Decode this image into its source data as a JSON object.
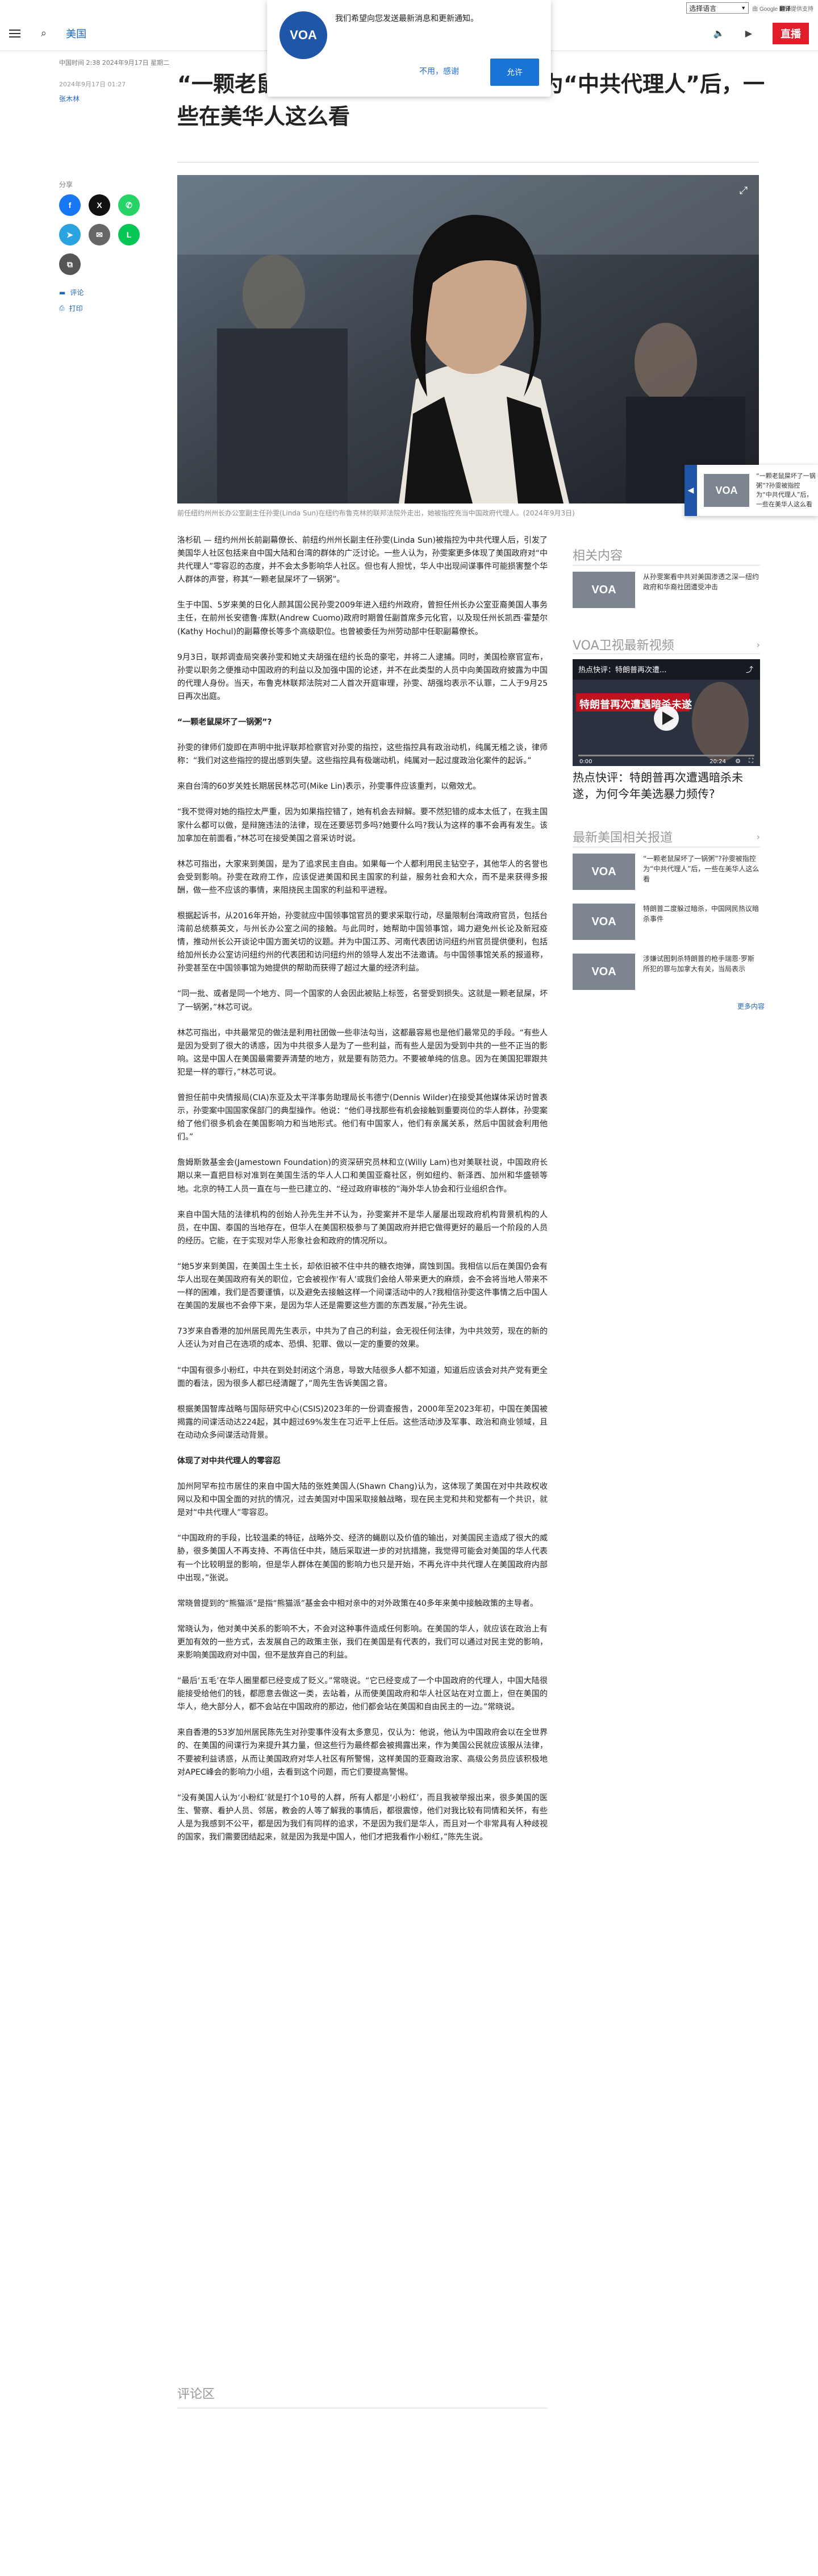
{
  "translate": {
    "select_label": "选择语言",
    "powered_by": "由 Google",
    "translate_word": "翻译",
    "powered_suffix": "提供支持"
  },
  "header": {
    "section": "美国",
    "live_label": "直播"
  },
  "notification": {
    "message": "我们希望向您发送最新消息和更新通知。",
    "later_label": "不用，感谢",
    "allow_label": "允许",
    "logo_text": "VOA"
  },
  "article": {
    "dateline": "中国时间 2:38 2024年9月17日 星期二",
    "updated": "2024年9月17日 01:27",
    "author": "张木林",
    "title": "“一颗老鼠屎坏了一锅粥”?孙雯被指控为“中共代理人”后，一些在美华人这么看",
    "caption": "前任纽约州州长办公室副主任孙雯(Linda Sun)在纽约布鲁克林的联邦法院外走出，她被指控充当中国政府代理人。(2024年9月3日)",
    "paragraphs": [
      "洛杉矶 — 纽约州州长前副幕僚长、前纽约州州长副主任孙雯(Linda Sun)被指控为中共代理人后，引发了美国华人社区包括来自中国大陆和台湾的群体的广泛讨论。一些人认为，孙雯案更多体现了美国政府对“中共代理人”零容忍的态度，并不会太多影响华人社区。但也有人担忧，华人中出现间谍事件可能损害整个华人群体的声誉，称其“一颗老鼠屎坏了一锅粥”。",
      "生于中国、5岁来美的日化人颜其国公民孙雯2009年进入纽约州政府，曾担任州长办公室亚裔美国人事务主任，在前州长安德鲁·库默(Andrew Cuomo)政府时期曾任副首席多元化官，以及现任州长凯西·霍楚尔(Kathy Hochul)的副幕僚长等多个高级职位。也曾被委任为州劳动部中任职副幕僚长。",
      "9月3日，联邦调查局突袭孙雯和她丈夫胡强在纽约长岛的豪宅，并将二人逮捕。同时，美国检察官宣布，孙雯以职务之便推动中国政府的利益以及加强中国的论述，并不在此类型的人员中向美国政府披露为中国的代理人身份。当天，布鲁克林联邦法院对二人首次开庭审理，孙雯、胡强均表示不认罪，二人于9月25日再次出庭。",
      "“一颗老鼠屎坏了一锅粥”?",
      "孙雯的律师们旋即在声明中批评联邦检察官对孙雯的指控，这些指控具有政治动机，纯属无稽之谈，律师称：“我们对这些指控的提出感到失望。这些指控具有极端动机，纯属对一起过度政治化案件的起诉。”",
      "来自台湾的60岁关姓长期居民林芯可(Mike Lin)表示，孙雯事件应该重判，以儆效尤。",
      "“我不觉得对她的指控太严重，因为如果指控错了，她有机会去辩解。要不然犯错的成本太低了，在我主国家什么都可以做，是辩施违法的法律，现在还要惩罚多吗?她要什么吗?我认为这样的事不会再有发生。该加拿加在前面看，”林芯可在接受美国之音采访时说。",
      "林芯可指出，大家来到美国，是为了追求民主自由。如果每一个人都利用民主钻空子，其他华人的名誉也会受到影响。孙雯在政府工作，应该促进美国和民主国家的利益，服务社会和大众，而不是来获得多报酬，做一些不应该的事情，来阻挠民主国家的利益和平进程。",
      "根据起诉书，从2016年开始，孙雯就应中国领事馆官员的要求采取行动，尽量限制台湾政府官员，包括台湾前总统蔡英文，与州长办公室之间的接触。与此同时，她帮助中国领事馆，竭力避免州长论及新冠疫情，推动州长公开谈论中国方面关切的议题。并为中国江苏、河南代表团访问纽约州官员提供便利，包括给加州长办公室访问纽约州的代表团和访问纽约州的领导人发出不法邀请。与中国领事馆关系的报道称，孙雯甚至在中国领事馆为她提供的帮助而获得了超过大量的经济利益。",
      "“同一批、或者是同一个地方、同一个国家的人会因此被贴上标签，名誉受到损失。这就是一颗老鼠屎，坏了一锅粥，”林芯可说。",
      "林芯可指出，中共最常见的做法是利用社团做一些非法勾当，这都最容易也是他们最常见的手段。“有些人是因为受到了很大的诱惑，因为中共很多人是为了一些利益，而有些人是因为受到中共的一些不正当的影响。这是中国人在美国最需要弄清楚的地方，就是要有防范力。不要被单纯的信息。因为在美国犯罪跟共犯是一样的罪行，”林芯可说。",
      "曾担任前中央情报局(CIA)东亚及太平洋事务助理局长韦德宁(Dennis Wilder)在接受其他媒体采访时曾表示，孙雯案中国国家保部门的典型操作。他说：“他们寻找那些有机会接触到重要岗位的华人群体，孙雯案给了他们很多机会在美国影响力和当地形式。他们有中国家人，他们有亲属关系，然后中国就会利用他们。”",
      "詹姆斯敦基金会(Jamestown Foundation)的资深研究员林和立(Willy Lam)也对美联社说，中国政府长期以来一直把目标对准到在美国生活的华人人口和美国亚裔社区，例如纽约、新泽西、加州和华盛顿等地。北京的特工人员一直在与一些已建立的、“经过政府审核的”海外华人协会和行业组织合作。",
      "来自中国大陆的法律机构的创始人孙先生并不认为，孙雯案并不是华人屡屡出现政府机构背景机构的人员，在中国、泰国的当地存在，但华人在美国积极参与了美国政府并把它做得更好的最后一个阶段的人员的经历。它能，在于实现对华人形象社会和政府的情况所以。",
      "“她5岁来到美国，在美国土生土长，却依旧被不住中共的糖衣炮弹，腐蚀到国。我相信以后在美国仍会有华人出现在美国政府有关的职位，它会被视作'有人'或我们会给人带来更大的麻烦，会不会将当地人带来不一样的困难，我们是否要谨慎，以及避免去接触这样一个间谍活动中的人?我相信孙雯这件事情之后中国人在美国的发展也不会停下来，是因为华人还是需要这些方面的东西发展，”孙先生说。",
      "73岁来自香港的加州居民周先生表示，中共为了自己的利益，会无视任何法律，为中共效劳，现在的新的人还认为对自己在选项的成本、恐惧、犯罪、做以一定的重要的效果。",
      "“中国有很多小粉红，中共在到处封闭这个消息，导致大陆很多人都不知道，知道后应该会对共产党有更全面的看法，因为很多人都已经清醒了，”周先生告诉美国之音。",
      "根据美国智库战略与国际研究中心(CSIS)2023年的一份调查报告，2000年至2023年初，中国在美国被揭露的间谍活动达224起，其中超过69%发生在习近平上任后。这些活动涉及军事、政治和商业领域，且在动动众多间谍活动背景。",
      "体现了对中共代理人的零容忍",
      "加州阿罕布拉市居住的来自中国大陆的张姓美国人(Shawn Chang)认为，这体现了美国在对中共政权收网以及和中国全面的对抗的情况，过去美国对中国采取接触战略，现在民主党和共和党都有一个共识，就是对“中共代理人”零容忍。",
      "“中国政府的手段，比较温柔的特征，战略外交、经济的蝇剧以及价值的输出，对美国民主造成了很大的威胁，很多美国人不再支持、不再信任中共，随后采取进一步的对抗措施，我觉得可能会对美国的华人代表有一个比较明显的影响，但是华人群体在美国的影响力也只是开始，不再允许中共代理人在美国政府内部中出现，”张说。",
      "常晓曾提到的“熊猫派”是指“熊猫派”基金会中相对亲中的对外政策在40多年来美中接触政策的主导者。",
      "常晓认为，他对美中关系的影响不大，不会对这种事件造成任何影响。在美国的华人，就应该在政治上有更加有效的一些方式，去发展自己的政策主张，我们在美国是有代表的，我们可以通过对民主党的影响，来影响美国政府对中国，但不是放弃自己的利益。",
      "“最后‘五毛’在华人圈里都已经变成了贬义。”常晓说。“它已经变成了一个中国政府的代理人，中国大陆很能接受给他们的钱，都愿意去做这一类，去站着，从而使美国政府和华人社区站在对立面上，但在美国的华人，绝大部分人，都不会站在中国政府的那边，他们都会站在美国和自由民主的一边。”常晓说。",
      "来自香港的53岁加州居民陈先生对孙雯事件没有太多意见，仅认为：他说，他认为中国政府会以在全世界的、在美国的间谍行为来提升其力量，但这些行为最终都会被揭露出来，作为美国公民就应该服从法律，不要被利益诱惑，从而让美国政府对华人社区有所警惕，这样美国的亚裔政治家、高级公务员应该积极地对APEC峰会的影响力小组，去看到这个问题，而它们要提高警惕。",
      "“没有美国人认为‘小粉红’就是打个10号的人群，所有人都是‘小粉红’，而且我被举报出来，很多美国的医生、警察、看护人员、邻居，教会的人等了解我的事情后，都很震惊，他们对我比较有同情和关怀，有些人是为我感到不公平，都是因为我们有同样的追求，不是因为我们是华人，而且对一个非常具有人种歧视的国家，我们需要团结起来，就是因为我是中国人，他们才把我看作小粉红，”陈先生说。"
    ],
    "share_label": "分享",
    "comment_label": "评论",
    "print_label": "打印",
    "comments_heading": "评论区"
  },
  "sidebar": {
    "related_title": "相关内容",
    "related_items": [
      {
        "text": "从孙雯案看中共对美国渗透之深—纽约政府和华裔社团遭受冲击",
        "thumb": "VOA"
      }
    ],
    "tv_title": "VOA卫视最新视频",
    "video_title": "热点快评：特朗普再次遭遇暗杀未遂，为何今年美选暴力频传?",
    "video_overlay_title": "热点快评：特朗普再次遭...",
    "video_banner": "特朗普再次遭遇暗杀未遂",
    "video_time_current": "0:00",
    "video_time_total": "20:24",
    "latest_title": "最新美国相关报道",
    "latest_items": [
      {
        "text": "“一颗老鼠屎坏了一锅粥”?孙雯被指控为“中共代理人”后，一些在美华人这么看",
        "thumb": "VOA"
      },
      {
        "text": "特朗普二度躲过暗杀，中国网民热议暗杀事件",
        "thumb": "VOA"
      },
      {
        "text": "涉嫌试图刺杀特朗普的枪手瑞恩·罗斯所犯的罪与加拿大有关，当局表示",
        "thumb": "VOA"
      }
    ],
    "more_label": "更多内容"
  },
  "float_card": {
    "text": "“一颗老鼠屎坏了一锅粥”?孙雯被指控为“中共代理人”后，一些在美华人这么看",
    "thumb": "VOA"
  }
}
